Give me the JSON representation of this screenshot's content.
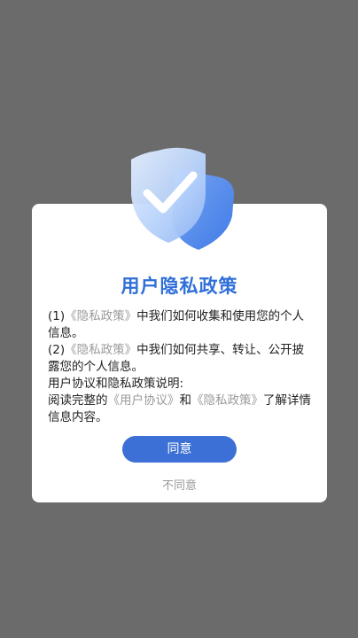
{
  "dialog": {
    "title": "用户隐私政策",
    "paragraph1": {
      "prefix": "(1)",
      "link": "《隐私政策》",
      "rest": "中我们如何收集和使用您的个人信息。"
    },
    "paragraph2": {
      "prefix": "(2)",
      "link": "《隐私政策》",
      "rest": "中我们如何共享、转让、公开披露您的个人信息。"
    },
    "paragraph3": "用户协议和隐私政策说明:",
    "paragraph4": {
      "prefix": "阅读完整的",
      "link1": "《用户协议》",
      "middle": "和",
      "link2": "《隐私政策》",
      "suffix": "了解详情信息内容。"
    },
    "agree_label": "同意",
    "disagree_label": "不同意"
  },
  "colors": {
    "overlay": "#6b6b6b",
    "accent": "#3d70d6",
    "title": "#2f6fd8",
    "link": "#9a9a9a"
  },
  "icons": {
    "shield": "shield-check-icon"
  }
}
